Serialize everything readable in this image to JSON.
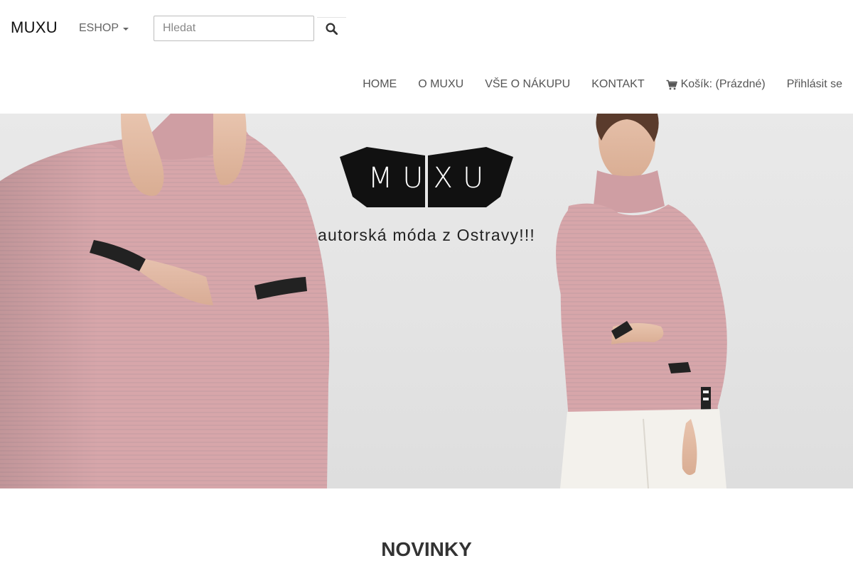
{
  "header": {
    "brand": "MUXU",
    "eshop_label": "ESHOP",
    "search": {
      "placeholder": "Hledat",
      "value": ""
    }
  },
  "nav": {
    "items": [
      {
        "label": "HOME"
      },
      {
        "label": "O MUXU"
      },
      {
        "label": "VŠE O NÁKUPU"
      },
      {
        "label": "KONTAKT"
      },
      {
        "label": "Košík: (Prázdné)",
        "icon": "cart-icon"
      },
      {
        "label": "Přihlásit se"
      }
    ]
  },
  "hero": {
    "logo_text": "MUXU",
    "tagline": "autorská móda z Ostravy!!!"
  },
  "sections": {
    "new_title": "NOVINKY"
  },
  "colors": {
    "accent_text": "#333333",
    "sweater_pink": "#d9aaae",
    "logo_black": "#111111"
  }
}
